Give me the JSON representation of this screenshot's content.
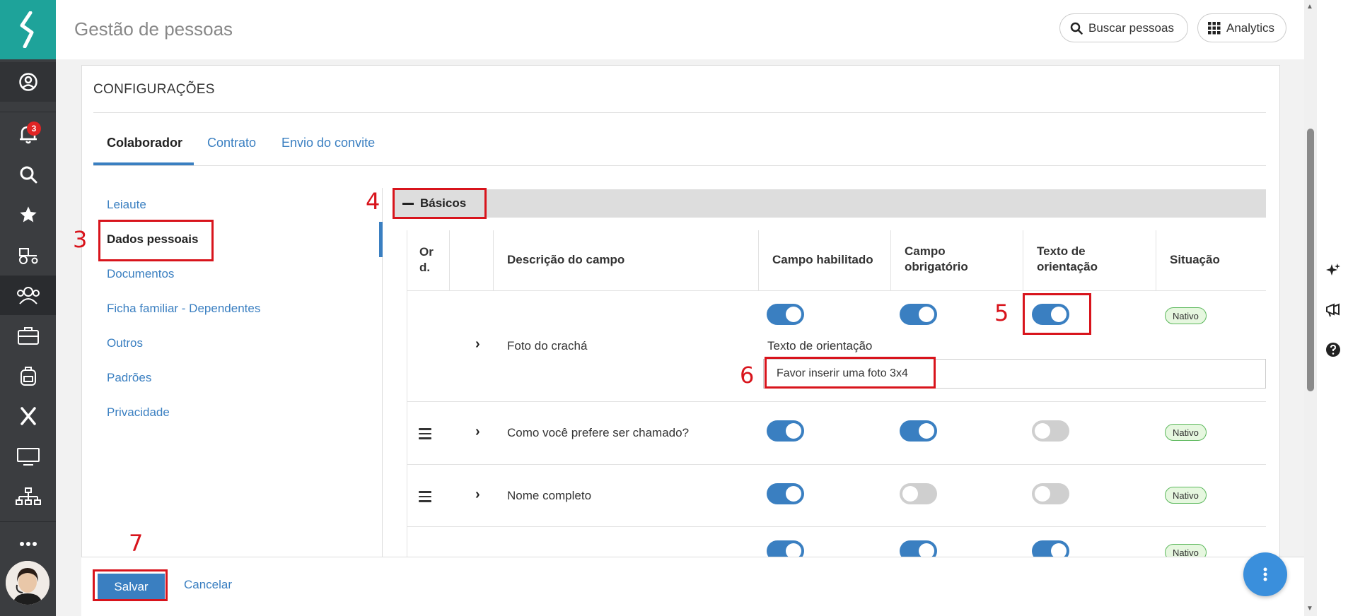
{
  "header": {
    "title": "Gestão de pessoas",
    "search_label": "Buscar pessoas",
    "analytics_label": "Analytics"
  },
  "nav": {
    "notification_count": "3"
  },
  "config": {
    "title": "CONFIGURAÇÕES",
    "tabs": [
      "Colaborador",
      "Contrato",
      "Envio do convite"
    ],
    "active_tab": "Colaborador",
    "side_items": [
      "Leiaute",
      "Dados pessoais",
      "Documentos",
      "Ficha familiar - Dependentes",
      "Outros",
      "Padrões",
      "Privacidade"
    ],
    "active_side_item": "Dados pessoais"
  },
  "section": {
    "title": "Básicos",
    "columns": {
      "order": "Or d.",
      "description": "Descrição do campo",
      "enabled": "Campo habilitado",
      "required": "Campo obrigatório",
      "guidance": "Texto de orientação",
      "status": "Situação"
    },
    "rows": [
      {
        "description": "Foto do crachá",
        "enabled": true,
        "required": true,
        "guidance": true,
        "status": "Nativo",
        "guidance_label": "Texto de orientação",
        "guidance_value": "Favor inserir uma foto 3x4"
      },
      {
        "description": "Como você prefere ser chamado?",
        "enabled": true,
        "required": true,
        "guidance": false,
        "status": "Nativo"
      },
      {
        "description": "Nome completo",
        "enabled": true,
        "required": false,
        "guidance": false,
        "status": "Nativo"
      },
      {
        "description": "",
        "enabled": true,
        "required": true,
        "guidance": true,
        "status": "Nativo"
      }
    ]
  },
  "footer": {
    "save_label": "Salvar",
    "cancel_label": "Cancelar"
  },
  "annotations": [
    "3",
    "4",
    "5",
    "6",
    "7"
  ],
  "colors": {
    "accent": "#3a7fc1",
    "logo_bg": "#1ea39a",
    "rail_bg": "#3b3d40",
    "annotation_red": "#d8141c"
  }
}
